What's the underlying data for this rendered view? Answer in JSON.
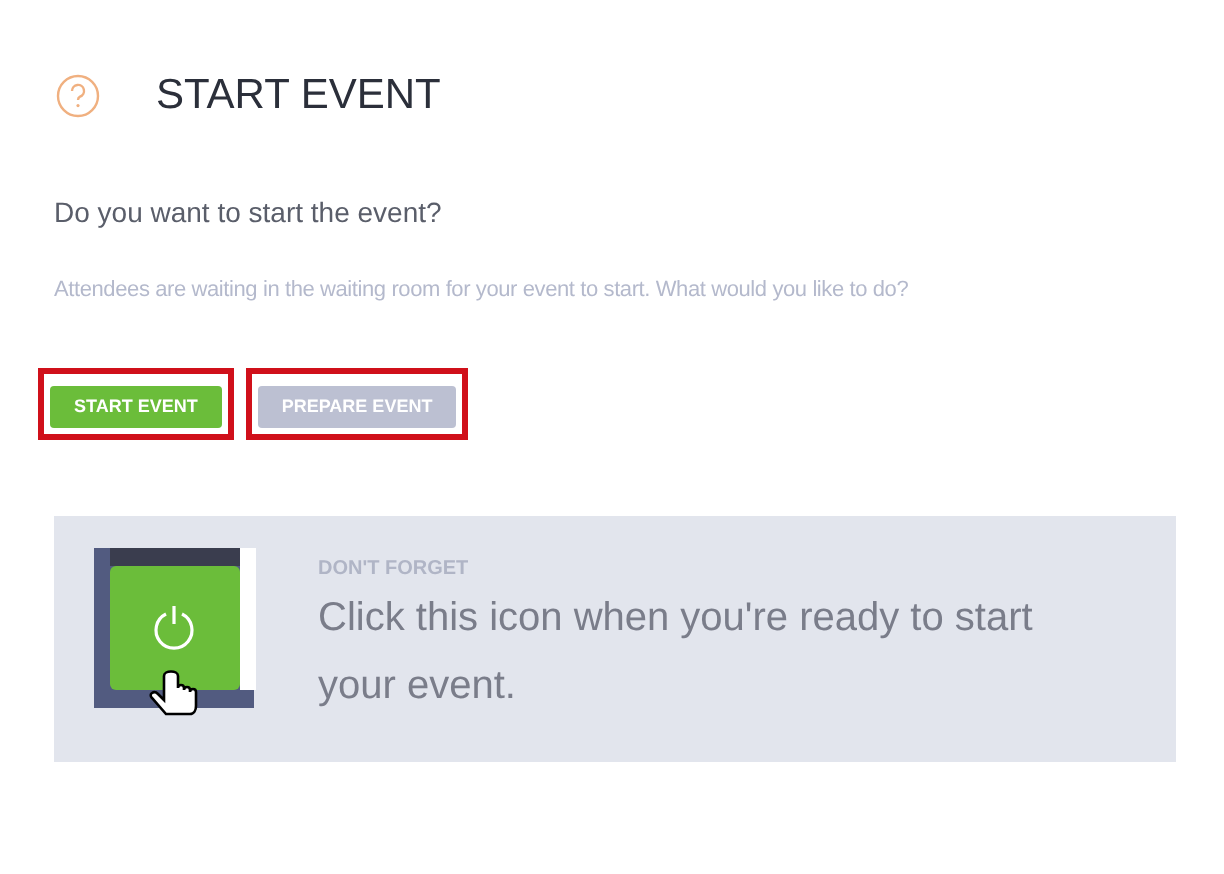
{
  "title": "START EVENT",
  "question": "Do you want to start the event?",
  "description": "Attendees are waiting in the waiting room for your event to start. What would you like to do?",
  "buttons": [
    {
      "label": "START EVENT",
      "kind": "primary"
    },
    {
      "label": "PREPARE EVENT",
      "kind": "secondary"
    }
  ],
  "tip": {
    "heading": "DON'T FORGET",
    "text": "Click this icon when you're ready to start your event."
  }
}
